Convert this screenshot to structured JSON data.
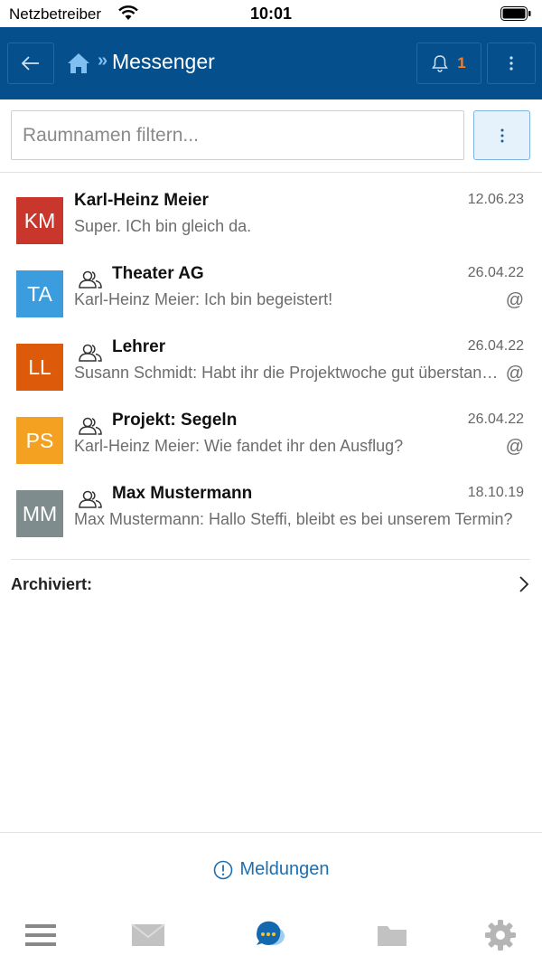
{
  "status_bar": {
    "carrier": "Netzbetreiber",
    "time": "10:01"
  },
  "header": {
    "title": "Messenger",
    "breadcrumb_separator": "»",
    "notification_count": "1"
  },
  "filter": {
    "placeholder": "Raumnamen filtern..."
  },
  "rooms": [
    {
      "initials": "KM",
      "color": "#c9372c",
      "group": false,
      "name": "Karl-Heinz Meier",
      "date": "12.06.23",
      "message": "Super. ICh bin gleich da.",
      "mention": ""
    },
    {
      "initials": "TA",
      "color": "#3b9ddd",
      "group": true,
      "name": "Theater AG",
      "date": "26.04.22",
      "message": "Karl-Heinz Meier: Ich bin begeistert!",
      "mention": "@"
    },
    {
      "initials": "LL",
      "color": "#dd5a0b",
      "group": true,
      "name": "Lehrer",
      "date": "26.04.22",
      "message": "Susann Schmidt: Habt ihr die Projektwoche gut überstanden?",
      "mention": "@"
    },
    {
      "initials": "PS",
      "color": "#f4a020",
      "group": true,
      "name": "Projekt: Segeln",
      "date": "26.04.22",
      "message": "Karl-Heinz Meier: Wie fandet ihr den Ausflug?",
      "mention": "@"
    },
    {
      "initials": "MM",
      "color": "#7f8c8d",
      "group": true,
      "name": "Max Mustermann",
      "date": "18.10.19",
      "message": "Max Mustermann: Hallo Steffi, bleibt es bei unserem Termin?",
      "mention": ""
    }
  ],
  "archived": {
    "label": "Archiviert:"
  },
  "notices": {
    "label": "Meldungen"
  },
  "tabbar": {
    "items": [
      "menu-icon",
      "mail-icon",
      "messenger-icon",
      "folder-icon",
      "settings-icon"
    ],
    "active": "messenger-icon"
  },
  "colors": {
    "header_bg": "#054f8c",
    "accent": "#1d6eb0",
    "badge": "#f07f2a"
  }
}
